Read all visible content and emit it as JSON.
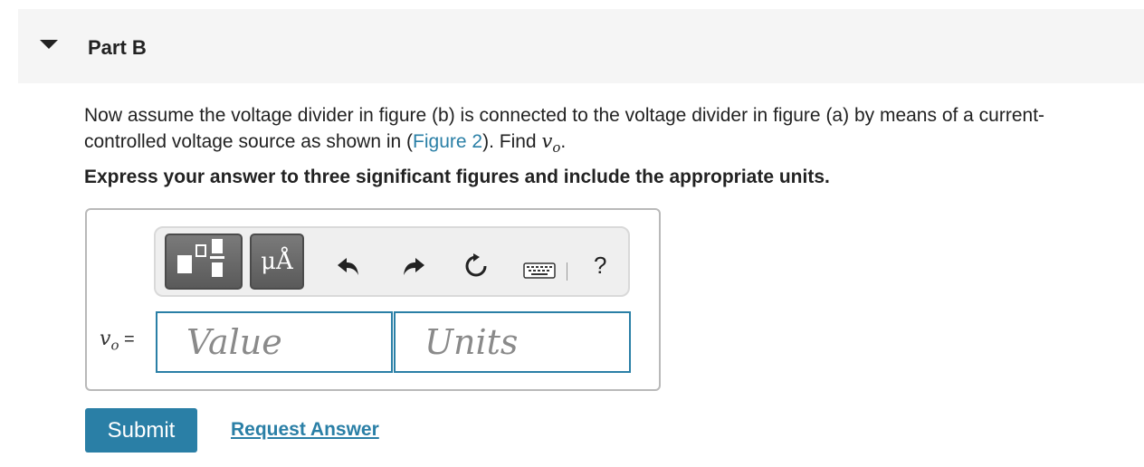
{
  "part": {
    "title": "Part B"
  },
  "question": {
    "text_before_link": "Now assume the voltage divider in figure (b) is connected to the voltage divider in figure (a) by means of a current-controlled voltage source as shown in (",
    "link_text": "Figure 2",
    "text_after_link": "). Find ",
    "variable": "v",
    "subscript": "o",
    "end": "."
  },
  "instructions": "Express your answer to three significant figures and include the appropriate units.",
  "toolbar": {
    "units_button_label": "μÅ",
    "help_label": "?",
    "icons": [
      "templates-icon",
      "units-icon",
      "undo-icon",
      "redo-icon",
      "reset-icon",
      "keyboard-icon",
      "help-icon"
    ]
  },
  "answer": {
    "label_var": "v",
    "label_sub": "o",
    "label_eq": " =",
    "value_placeholder": "Value",
    "units_placeholder": "Units"
  },
  "actions": {
    "submit_label": "Submit",
    "request_label": "Request Answer"
  },
  "colors": {
    "accent": "#2a7fa6",
    "header_bg": "#f5f5f5",
    "toolbar_button": "#666666"
  }
}
